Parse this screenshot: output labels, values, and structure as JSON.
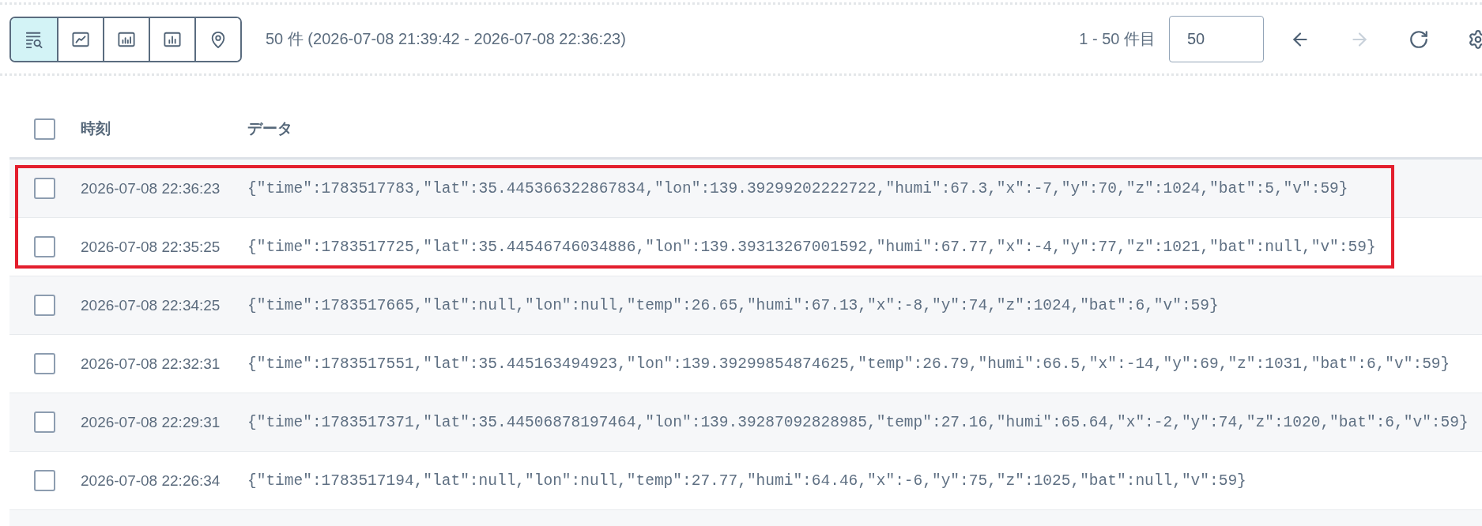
{
  "view_buttons": [
    {
      "kind": "list",
      "selected": true
    },
    {
      "kind": "line",
      "selected": false
    },
    {
      "kind": "bar",
      "selected": false
    },
    {
      "kind": "column",
      "selected": false
    },
    {
      "kind": "map",
      "selected": false
    }
  ],
  "summary": "50 件 (2026-07-08 21:39:42 - 2026-07-08 22:36:23)",
  "pagination": {
    "range": "1 - 50 件目",
    "page_size": "50"
  },
  "actions": [
    {
      "kind": "prev",
      "disabled": false
    },
    {
      "kind": "next",
      "disabled": true
    },
    {
      "kind": "refresh",
      "disabled": false
    },
    {
      "kind": "settings",
      "disabled": false
    }
  ],
  "table": {
    "select_all": {
      "checked": false
    },
    "columns": [
      "時刻",
      "データ"
    ],
    "rows": [
      {
        "checked": false,
        "highlighted": true,
        "time": "2026-07-08 22:36:23",
        "data": "{\"time\":1783517783,\"lat\":35.445366322867834,\"lon\":139.39299202222722,\"humi\":67.3,\"x\":-7,\"y\":70,\"z\":1024,\"bat\":5,\"v\":59}"
      },
      {
        "checked": false,
        "highlighted": true,
        "time": "2026-07-08 22:35:25",
        "data": "{\"time\":1783517725,\"lat\":35.44546746034886,\"lon\":139.39313267001592,\"humi\":67.77,\"x\":-4,\"y\":77,\"z\":1021,\"bat\":null,\"v\":59}"
      },
      {
        "checked": false,
        "highlighted": false,
        "time": "2026-07-08 22:34:25",
        "data": "{\"time\":1783517665,\"lat\":null,\"lon\":null,\"temp\":26.65,\"humi\":67.13,\"x\":-8,\"y\":74,\"z\":1024,\"bat\":6,\"v\":59}"
      },
      {
        "checked": false,
        "highlighted": false,
        "time": "2026-07-08 22:32:31",
        "data": "{\"time\":1783517551,\"lat\":35.445163494923,\"lon\":139.39299854874625,\"temp\":26.79,\"humi\":66.5,\"x\":-14,\"y\":69,\"z\":1031,\"bat\":6,\"v\":59}"
      },
      {
        "checked": false,
        "highlighted": false,
        "time": "2026-07-08 22:29:31",
        "data": "{\"time\":1783517371,\"lat\":35.44506878197464,\"lon\":139.39287092828985,\"temp\":27.16,\"humi\":65.64,\"x\":-2,\"y\":74,\"z\":1020,\"bat\":6,\"v\":59}"
      },
      {
        "checked": false,
        "highlighted": false,
        "time": "2026-07-08 22:26:34",
        "data": "{\"time\":1783517194,\"lat\":null,\"lon\":null,\"temp\":27.77,\"humi\":64.46,\"x\":-6,\"y\":75,\"z\":1025,\"bat\":null,\"v\":59}"
      }
    ]
  }
}
